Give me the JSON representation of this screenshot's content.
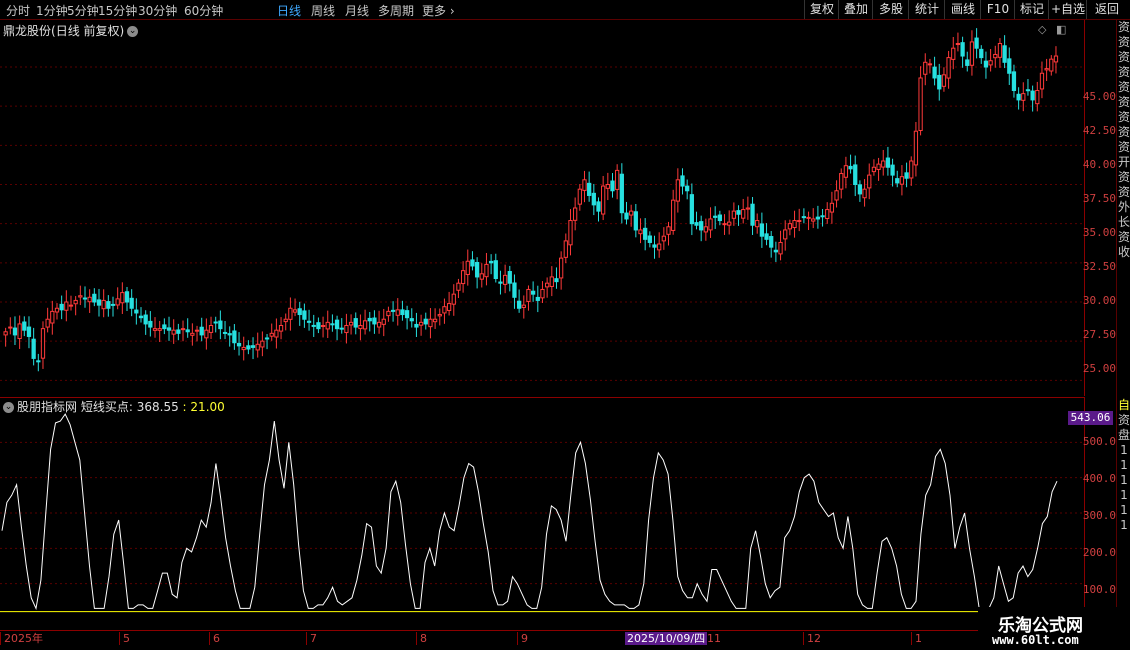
{
  "toolbar": {
    "timeframes": [
      "分时",
      "1分钟",
      "5分钟",
      "15分钟",
      "30分钟",
      "60分钟",
      "日线",
      "周线",
      "月线",
      "多周期",
      "更多"
    ],
    "active": "日线",
    "buttons": [
      "复权",
      "叠加",
      "多股",
      "统计",
      "画线",
      "F10",
      "标记",
      "+自选",
      "返回"
    ]
  },
  "stock": {
    "name": "鼎龙股份",
    "mode": "(日线 前复权)"
  },
  "price_axis": [
    "45.00",
    "42.50",
    "40.00",
    "37.50",
    "35.00",
    "32.50",
    "30.00",
    "27.50",
    "25.00"
  ],
  "indicator": {
    "source": "股朋指标网",
    "name": "短线买点:",
    "value1": "368.55",
    "value2": "21.00",
    "current_tag": "543.06",
    "axis": [
      "500.0",
      "400.0",
      "300.0",
      "200.0",
      "100.0"
    ]
  },
  "date_axis": {
    "labels": [
      "2025年",
      "5",
      "6",
      "7",
      "8",
      "9",
      "11",
      "12",
      "1"
    ],
    "cursor": "2025/10/09/四"
  },
  "right_strip": [
    "资",
    "资",
    "资",
    "资",
    "资",
    "资",
    "资",
    "资",
    "资",
    "开",
    "资",
    "资",
    "外",
    "长",
    "资",
    "收"
  ],
  "right_strip_bottom": [
    "自",
    "资",
    "盘",
    "1",
    "1",
    "1",
    "1",
    "1",
    "1"
  ],
  "watermark": {
    "line1": "乐淘公式网",
    "line2": "www.60lt.com"
  },
  "colors": {
    "up": "#ff3a3a",
    "down": "#27e0e0",
    "line": "#ffffff",
    "baseline": "#ffff00",
    "axis": "#d04040",
    "grid": "#5a0000"
  },
  "chart_data": [
    {
      "type": "candlestick",
      "title": "鼎龙股份 (日线 前复权)",
      "ylim": [
        24,
        48
      ],
      "closes": [
        28.1,
        28.4,
        27.9,
        28.6,
        28.2,
        27.8,
        26.4,
        26.2,
        28.3,
        28.9,
        29.4,
        29.6,
        29.5,
        30.0,
        29.8,
        30.1,
        30.4,
        30.2,
        30.3,
        30.0,
        29.8,
        30.1,
        29.6,
        29.8,
        30.2,
        30.6,
        30.0,
        29.6,
        29.3,
        29.0,
        28.6,
        28.4,
        28.3,
        28.3,
        28.3,
        28.2,
        28.2,
        28.0,
        28.3,
        28.1,
        28.0,
        28.2,
        27.9,
        28.2,
        28.5,
        28.7,
        28.3,
        28.0,
        27.9,
        27.4,
        27.2,
        27.1,
        27.0,
        27.1,
        27.3,
        27.5,
        27.7,
        28.0,
        28.2,
        28.5,
        28.9,
        29.6,
        29.5,
        29.2,
        28.9,
        28.7,
        28.5,
        28.3,
        28.5,
        28.7,
        28.6,
        28.3,
        28.3,
        28.5,
        28.7,
        28.4,
        28.5,
        28.8,
        28.8,
        28.6,
        28.7,
        28.9,
        29.4,
        29.4,
        29.5,
        29.2,
        29.0,
        28.8,
        28.4,
        28.7,
        28.6,
        28.9,
        28.9,
        29.2,
        29.7,
        29.9,
        30.5,
        31.2,
        32.0,
        32.6,
        32.3,
        31.6,
        31.8,
        32.4,
        32.5,
        31.5,
        31.2,
        31.7,
        31.2,
        30.3,
        29.6,
        29.8,
        30.8,
        30.5,
        30.1,
        30.8,
        31.2,
        31.6,
        31.3,
        32.8,
        33.9,
        35.2,
        36.0,
        37.2,
        37.8,
        36.8,
        36.2,
        35.8,
        37.4,
        37.5,
        37.1,
        38.4,
        35.7,
        35.3,
        35.8,
        34.6,
        34.6,
        34.0,
        33.8,
        33.5,
        33.7,
        34.2,
        34.8,
        36.5,
        37.8,
        37.4,
        37.1,
        35.0,
        34.9,
        34.6,
        34.8,
        35.3,
        35.4,
        35.2,
        35.0,
        35.1,
        35.8,
        35.6,
        35.9,
        36.0,
        34.9,
        35.2,
        34.2,
        34.0,
        33.5,
        33.2,
        33.8,
        34.6,
        35.0,
        35.2,
        35.2,
        35.4,
        35.4,
        35.3,
        35.3,
        35.5,
        35.9,
        36.3,
        37.1,
        38.2,
        38.7,
        38.5,
        37.5,
        36.9,
        37.2,
        38.1,
        38.6,
        38.8,
        39.0,
        38.6,
        38.1,
        37.6,
        38.0,
        37.9,
        39.0,
        40.9,
        44.3,
        45.3,
        45.2,
        44.3,
        43.6,
        44.5,
        45.6,
        46.2,
        46.5,
        45.7,
        45.1,
        46.6,
        46.2,
        45.6,
        45.0,
        45.4,
        45.8,
        46.5,
        45.3,
        44.6,
        43.5,
        42.9,
        43.3,
        43.5,
        42.9,
        43.5,
        44.6,
        44.9,
        45.5,
        45.7
      ]
    },
    {
      "type": "line",
      "title": "短线买点",
      "ylim": [
        0,
        600
      ],
      "baseline": 21.0,
      "values": [
        250,
        330,
        350,
        380,
        260,
        150,
        60,
        30,
        110,
        300,
        480,
        555,
        560,
        580,
        550,
        500,
        450,
        300,
        150,
        30,
        30,
        30,
        120,
        240,
        280,
        160,
        30,
        30,
        40,
        40,
        30,
        30,
        80,
        130,
        130,
        70,
        60,
        160,
        200,
        190,
        230,
        280,
        260,
        330,
        440,
        340,
        230,
        150,
        80,
        30,
        30,
        30,
        90,
        240,
        380,
        450,
        560,
        450,
        370,
        500,
        380,
        210,
        80,
        30,
        30,
        40,
        40,
        60,
        90,
        50,
        40,
        50,
        60,
        110,
        180,
        270,
        260,
        150,
        130,
        200,
        360,
        390,
        330,
        210,
        100,
        30,
        30,
        160,
        200,
        150,
        250,
        300,
        260,
        250,
        320,
        400,
        440,
        430,
        360,
        270,
        190,
        80,
        40,
        40,
        50,
        120,
        100,
        70,
        40,
        30,
        30,
        90,
        240,
        320,
        310,
        280,
        220,
        350,
        470,
        500,
        440,
        340,
        220,
        110,
        70,
        50,
        40,
        40,
        40,
        30,
        30,
        40,
        100,
        280,
        400,
        470,
        450,
        410,
        280,
        120,
        80,
        60,
        60,
        100,
        70,
        50,
        140,
        140,
        110,
        80,
        50,
        30,
        30,
        30,
        200,
        250,
        180,
        100,
        60,
        80,
        90,
        230,
        250,
        290,
        360,
        400,
        410,
        390,
        330,
        310,
        290,
        300,
        230,
        200,
        290,
        200,
        70,
        40,
        30,
        30,
        130,
        220,
        230,
        200,
        150,
        70,
        30,
        30,
        50,
        240,
        350,
        380,
        460,
        480,
        440,
        350,
        200,
        260,
        300,
        200,
        120,
        30,
        30,
        30,
        60,
        150,
        100,
        50,
        60,
        130,
        150,
        120,
        140,
        200,
        270,
        290,
        360,
        390
      ]
    }
  ]
}
